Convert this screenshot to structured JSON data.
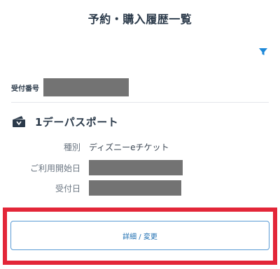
{
  "header": {
    "title": "予約・購入履歴一覧"
  },
  "filter": {
    "icon": "filter-icon",
    "color": "#1e88d8"
  },
  "receipt": {
    "label": "受付番号"
  },
  "ticket": {
    "icon": "ticket-icon",
    "title": "1デーパスポート",
    "rows": [
      {
        "label": "種別",
        "value": "ディズニーeチケット"
      },
      {
        "label": "ご利用開始日",
        "value": ""
      },
      {
        "label": "受付日",
        "value": ""
      }
    ]
  },
  "actions": {
    "detail_label": "詳細 / 変更"
  },
  "colors": {
    "text_primary": "#2b3a4a",
    "accent_blue": "#1f6fb2",
    "highlight_red": "#e32638",
    "redaction": "#737373"
  }
}
